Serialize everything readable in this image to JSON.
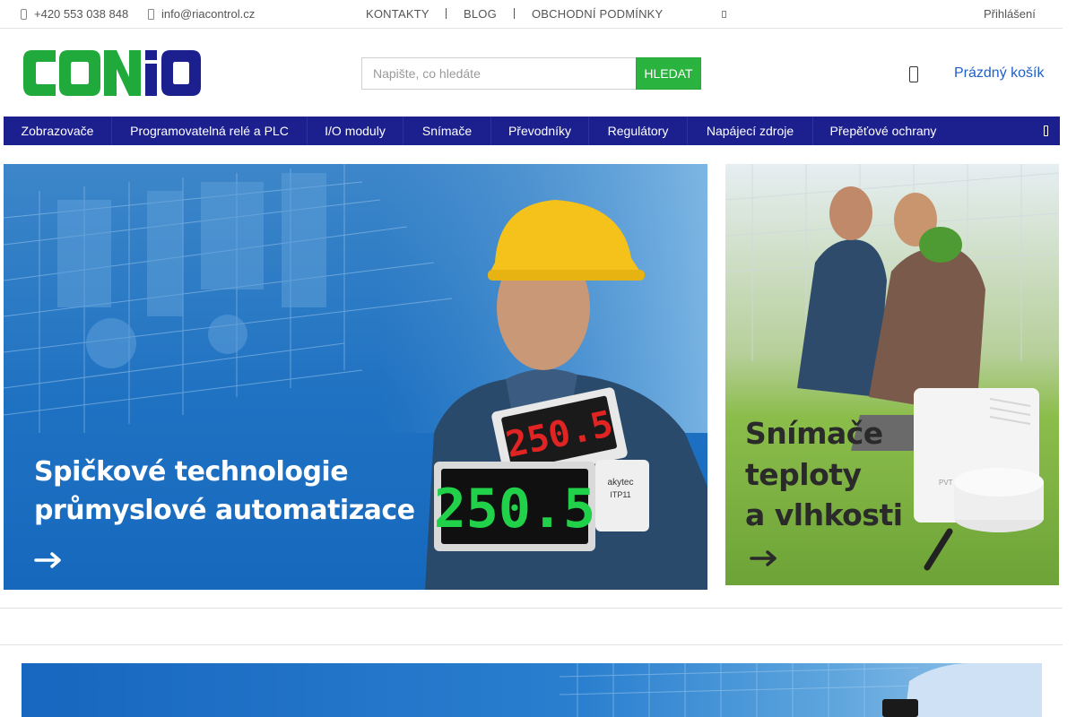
{
  "topbar": {
    "phone": "+420 553 038 848",
    "email": "info@riacontrol.cz",
    "links": [
      "KONTAKTY",
      "BLOG",
      "OBCHODNÍ PODMÍNKY"
    ],
    "login": "Přihlášení"
  },
  "header": {
    "logo_text": "CONiO",
    "search": {
      "placeholder": "Napište, co hledáte",
      "button": "HLEDAT"
    },
    "cart": {
      "label": "Prázdný košík"
    }
  },
  "nav": {
    "items": [
      "Zobrazovače",
      "Programovatelná relé a PLC",
      "I/O moduly",
      "Snímače",
      "Převodníky",
      "Regulátory",
      "Napájecí zdroje",
      "Přepěťové ochrany"
    ]
  },
  "banners": {
    "main": {
      "line1": "Spičkové technologie",
      "line2": "průmyslové automatizace",
      "display_value": "250.5",
      "device_brand": "akytec",
      "device_model": "ITP11"
    },
    "side": {
      "line1": "Snímače",
      "line2": "teploty",
      "line3": "a vlhkosti",
      "device_brand": "PVT"
    }
  },
  "colors": {
    "nav_bg": "#1c1f8e",
    "search_button": "#2bb33f",
    "logo_green": "#1faa3b",
    "logo_blue": "#1c1f8e",
    "cart_link": "#1f5fc6"
  }
}
